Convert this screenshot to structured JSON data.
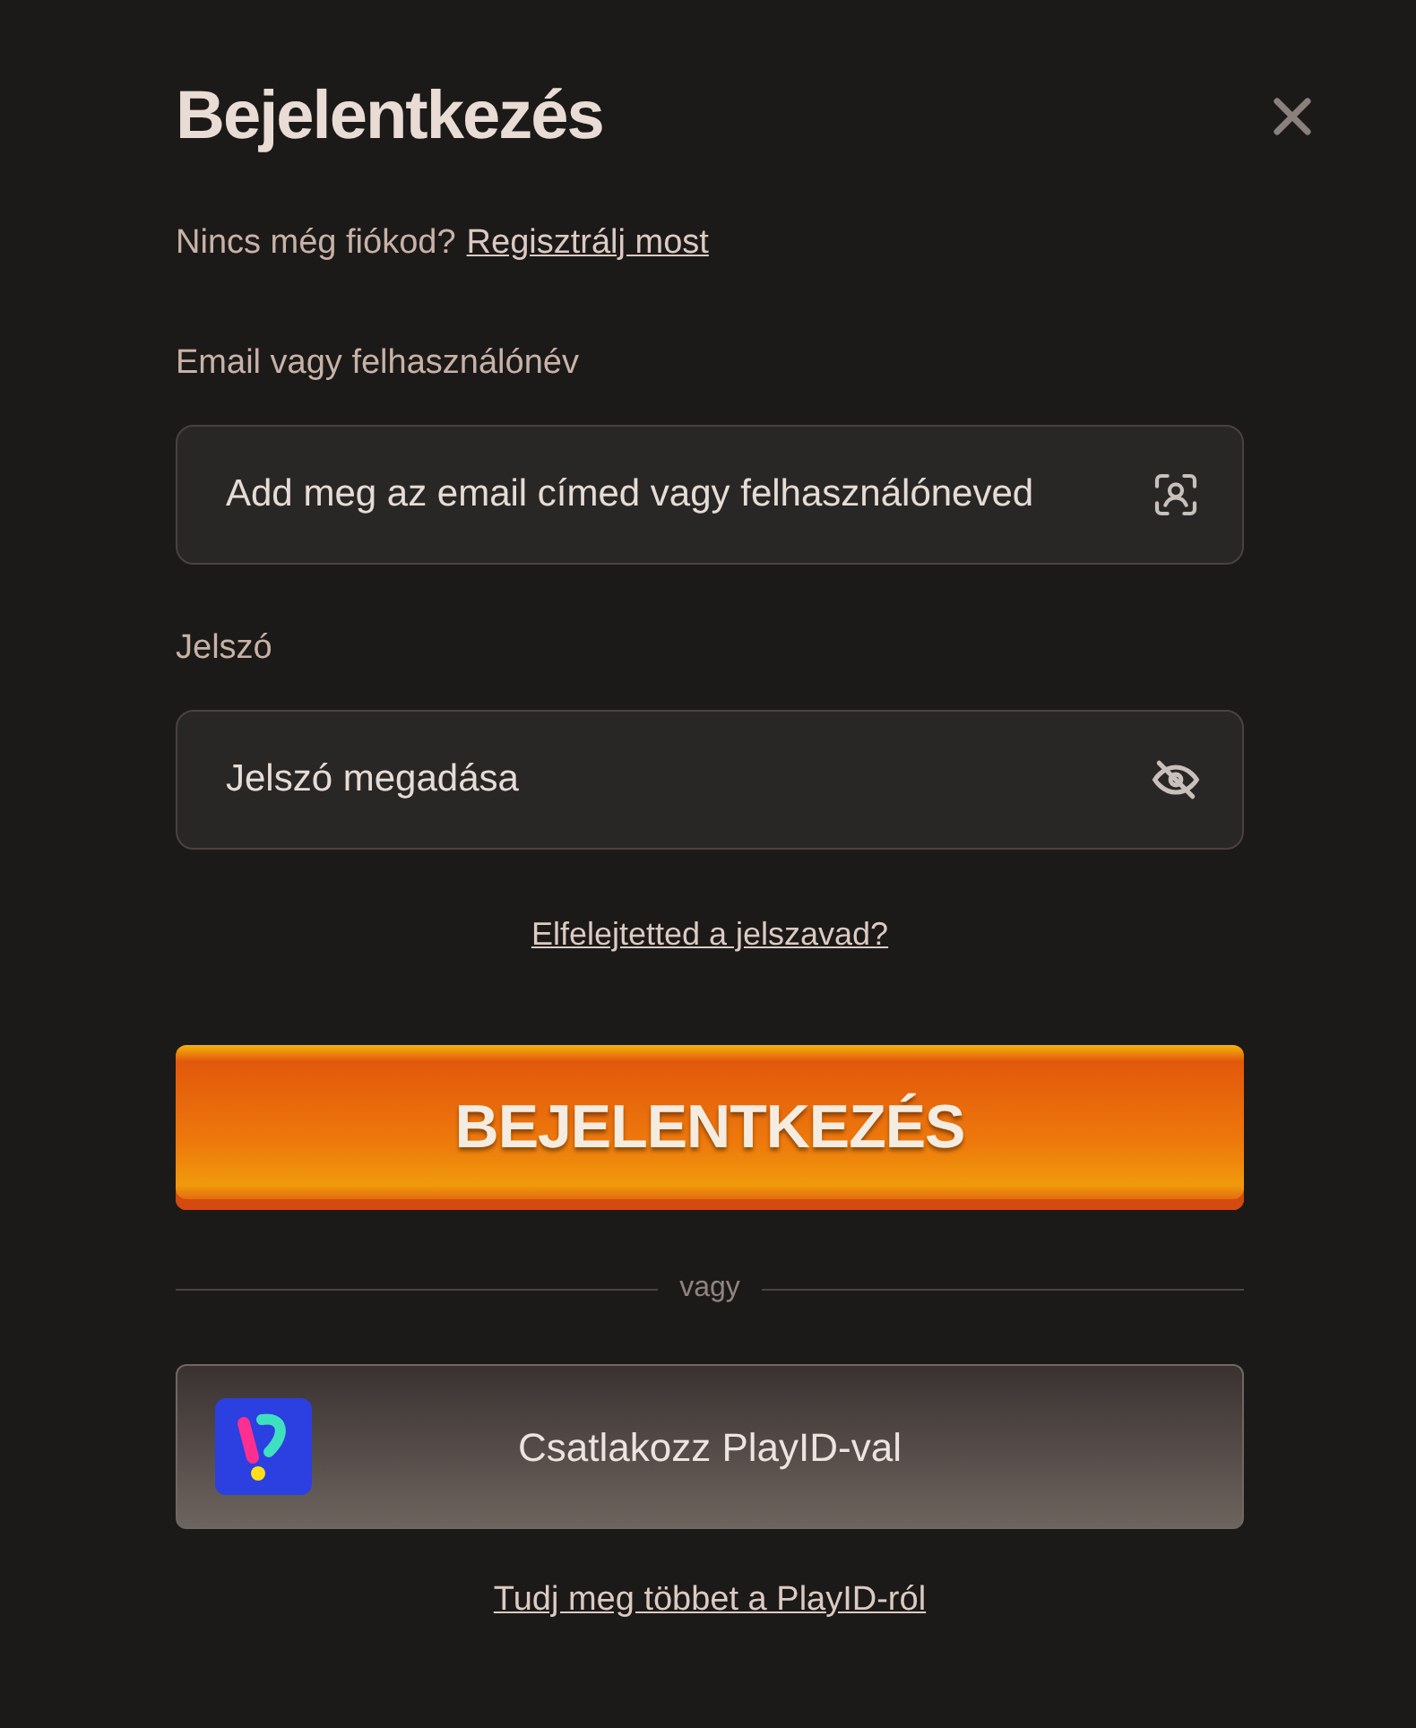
{
  "title": "Bejelentkezés",
  "register": {
    "prompt": "Nincs még fiókod?",
    "link": "Regisztrálj most"
  },
  "fields": [
    {
      "kind": "email",
      "label": "Email vagy felhasználónév",
      "placeholder": "Add meg az email címed vagy felhasználóneved"
    },
    {
      "kind": "password",
      "label": "Jelszó",
      "placeholder": "Jelszó megadása"
    }
  ],
  "forgot_link": "Elfelejtetted a jelszavad?",
  "login_button": "BEJELENTKEZÉS",
  "divider": "vagy",
  "playid_button": "Csatlakozz PlayID-val",
  "playid_link": "Tudj meg többet a PlayID-ról"
}
